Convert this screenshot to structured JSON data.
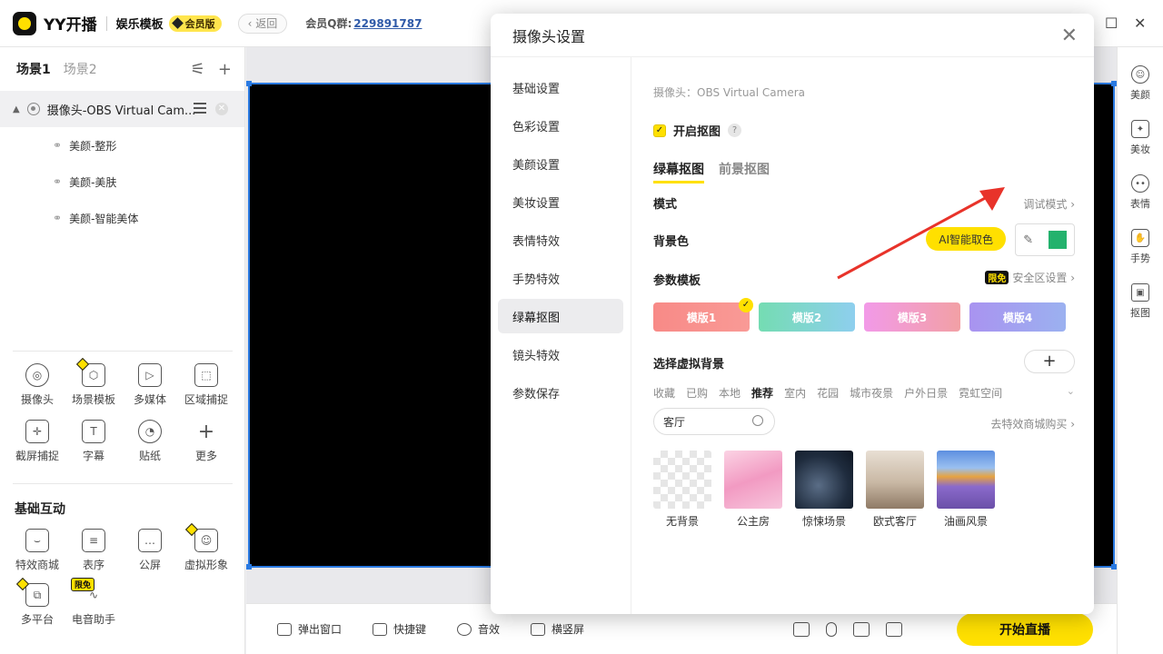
{
  "titlebar": {
    "app_name": "YY开播",
    "template_name": "娱乐模板",
    "vip_label": "会员版",
    "back_label": "返回",
    "qq_label": "会员Q群:",
    "qq_number": "229891787"
  },
  "scenes": {
    "tabs": [
      "场景1",
      "场景2"
    ]
  },
  "sources": {
    "camera": "摄像头-OBS Virtual Cam...",
    "children": [
      "美颜-整形",
      "美颜-美肤",
      "美颜-智能美体"
    ]
  },
  "tools": [
    {
      "label": "摄像头",
      "icon": "camera-icon"
    },
    {
      "label": "场景模板",
      "icon": "scene-template-icon"
    },
    {
      "label": "多媒体",
      "icon": "media-icon"
    },
    {
      "label": "区域捕捉",
      "icon": "region-capture-icon"
    },
    {
      "label": "截屏捕捉",
      "icon": "screenshot-capture-icon"
    },
    {
      "label": "字幕",
      "icon": "subtitle-icon"
    },
    {
      "label": "贴纸",
      "icon": "sticker-icon"
    },
    {
      "label": "更多",
      "icon": "more-icon"
    }
  ],
  "interaction": {
    "title": "基础互动",
    "items": [
      {
        "label": "特效商城",
        "icon": "effects-store-icon"
      },
      {
        "label": "表序",
        "icon": "list-icon"
      },
      {
        "label": "公屏",
        "icon": "chat-icon"
      },
      {
        "label": "虚拟形象",
        "icon": "avatar-icon"
      },
      {
        "label": "多平台",
        "icon": "multi-platform-icon"
      },
      {
        "label": "电音助手",
        "icon": "voice-assistant-icon"
      }
    ],
    "free_tag": "限免"
  },
  "bottombar": {
    "items": [
      "弹出窗口",
      "快捷键",
      "音效",
      "横竖屏"
    ],
    "start_live": "开始直播"
  },
  "rightbar": {
    "items": [
      "美颜",
      "美妆",
      "表情",
      "手势",
      "抠图"
    ]
  },
  "dialog": {
    "title": "摄像头设置",
    "nav": [
      "基础设置",
      "色彩设置",
      "美颜设置",
      "美妆设置",
      "表情特效",
      "手势特效",
      "绿幕抠图",
      "镜头特效",
      "参数保存"
    ],
    "active_nav": "绿幕抠图",
    "camera_name": "摄像头：OBS Virtual Camera",
    "enable_label": "开启抠图",
    "sub_tabs": [
      "绿幕抠图",
      "前景抠图"
    ],
    "mode_label": "模式",
    "debug_link": "调试模式",
    "bg_color_label": "背景色",
    "ai_pick": "AI智能取色",
    "swatch_color": "#23b26d",
    "param_label": "参数模板",
    "free_tag": "限免",
    "safe_zone": "安全区设置",
    "templates": [
      {
        "label": "模版1",
        "colors": [
          "#f88a87",
          "#f99a96"
        ]
      },
      {
        "label": "模版2",
        "colors": [
          "#74dcb2",
          "#8ecfee"
        ]
      },
      {
        "label": "模版3",
        "colors": [
          "#f29ae8",
          "#f2a0a5"
        ]
      },
      {
        "label": "模版4",
        "colors": [
          "#a993f0",
          "#9bb1f0"
        ]
      }
    ],
    "virtual_bg_label": "选择虚拟背景",
    "categories": [
      "收藏",
      "已购",
      "本地",
      "推荐",
      "室内",
      "花园",
      "城市夜景",
      "户外日景",
      "霓虹空间"
    ],
    "current_category": "推荐",
    "search_value": "客厅",
    "shop_link": "去特效商城购买",
    "backgrounds": [
      {
        "label": "无背景"
      },
      {
        "label": "公主房"
      },
      {
        "label": "惊悚场景"
      },
      {
        "label": "欧式客厅"
      },
      {
        "label": "油画风景"
      }
    ]
  }
}
